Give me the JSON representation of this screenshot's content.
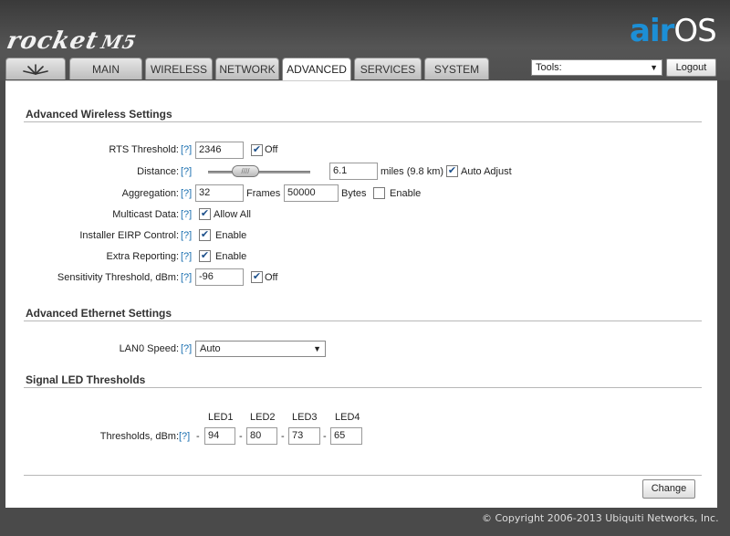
{
  "header": {
    "product": "rocket",
    "model": "M5",
    "brand_air": "air",
    "brand_os": "OS",
    "tabs": [
      "MAIN",
      "WIRELESS",
      "NETWORK",
      "ADVANCED",
      "SERVICES",
      "SYSTEM"
    ],
    "active_tab": "ADVANCED",
    "tools_label": "Tools:",
    "logout_label": "Logout"
  },
  "help_label": "[?]",
  "wireless": {
    "title": "Advanced Wireless Settings",
    "rts_label": "RTS Threshold:",
    "rts_value": "2346",
    "rts_off_label": "Off",
    "distance_label": "Distance:",
    "distance_value": "6.1",
    "distance_units": "miles (9.8 km)",
    "auto_adjust_label": "Auto Adjust",
    "aggregation_label": "Aggregation:",
    "aggregation_frames_value": "32",
    "frames_label": "Frames",
    "aggregation_bytes_value": "50000",
    "bytes_label": "Bytes",
    "enable_label": "Enable",
    "multicast_label": "Multicast Data:",
    "allow_all_label": "Allow All",
    "eirp_label": "Installer EIRP Control:",
    "extra_reporting_label": "Extra Reporting:",
    "sensitivity_label": "Sensitivity Threshold, dBm:",
    "sensitivity_value": "-96"
  },
  "ethernet": {
    "title": "Advanced Ethernet Settings",
    "lan0_label": "LAN0 Speed:",
    "lan0_value": "Auto"
  },
  "led": {
    "title": "Signal LED Thresholds",
    "thresholds_label": "Thresholds, dBm:",
    "headers": [
      "LED1",
      "LED2",
      "LED3",
      "LED4"
    ],
    "values": [
      "94",
      "80",
      "73",
      "65"
    ],
    "dash": "-"
  },
  "change_label": "Change",
  "copyright": "© Copyright 2006-2013 Ubiquiti Networks, Inc."
}
